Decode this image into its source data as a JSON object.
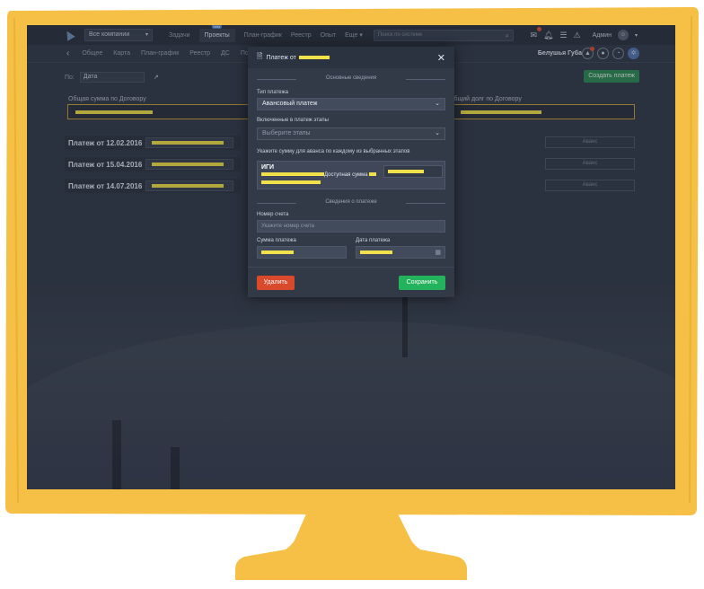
{
  "colors": {
    "frame": "#f5c045",
    "screen_bg": "#343c4b",
    "save": "#22b35c",
    "delete": "#d9492c",
    "highlight": "#f0e04a",
    "create": "#2e8a56"
  },
  "topbar": {
    "company": "Все компании",
    "nav": [
      "Задачи",
      "Проекты",
      "План-график",
      "Реестр",
      "Опыт",
      "Еще"
    ],
    "badge": "beta",
    "search_placeholder": "Поиск по системе",
    "user": "Админ",
    "icons": [
      "mail-icon",
      "bell-icon",
      "list-icon",
      "warning-icon",
      "avatar-icon"
    ]
  },
  "subbar": {
    "tabs": [
      "Общее",
      "Карта",
      "План-график",
      "Реестр",
      "ДС",
      "Пор"
    ],
    "place": "Белушья Губа"
  },
  "filter": {
    "label": "По:",
    "value": "Дата"
  },
  "create_button": "Создать платеж",
  "totals": {
    "left_label": "Общая сумма по Договору",
    "right_label": "Общий долг по Договору"
  },
  "payments": [
    {
      "title": "Платеж от 12.02.2016",
      "type": "Аванс"
    },
    {
      "title": "Платеж от 15.04.2016",
      "type": "Аванс"
    },
    {
      "title": "Платеж от 14.07.2016",
      "type": "Аванс"
    }
  ],
  "modal": {
    "title": "Платеж от",
    "section_main": "Основные сведения",
    "type_label": "Тип платежа",
    "type_value": "Авансовый платеж",
    "stages_label": "Включенные в платеж этапы",
    "stages_placeholder": "Выберите этапы",
    "amount_hint": "Укажите сумму для аванса по каждому из выбранных этапов",
    "stage_name": "ИГИ",
    "available": "Доступная сумма",
    "section_payment": "Сведения о платеже",
    "invoice_label": "Номер счета",
    "invoice_placeholder": "Укажите номер счета",
    "sum_label": "Сумма платежа",
    "date_label": "Дата платежа",
    "delete": "Удалить",
    "save": "Сохранить"
  }
}
